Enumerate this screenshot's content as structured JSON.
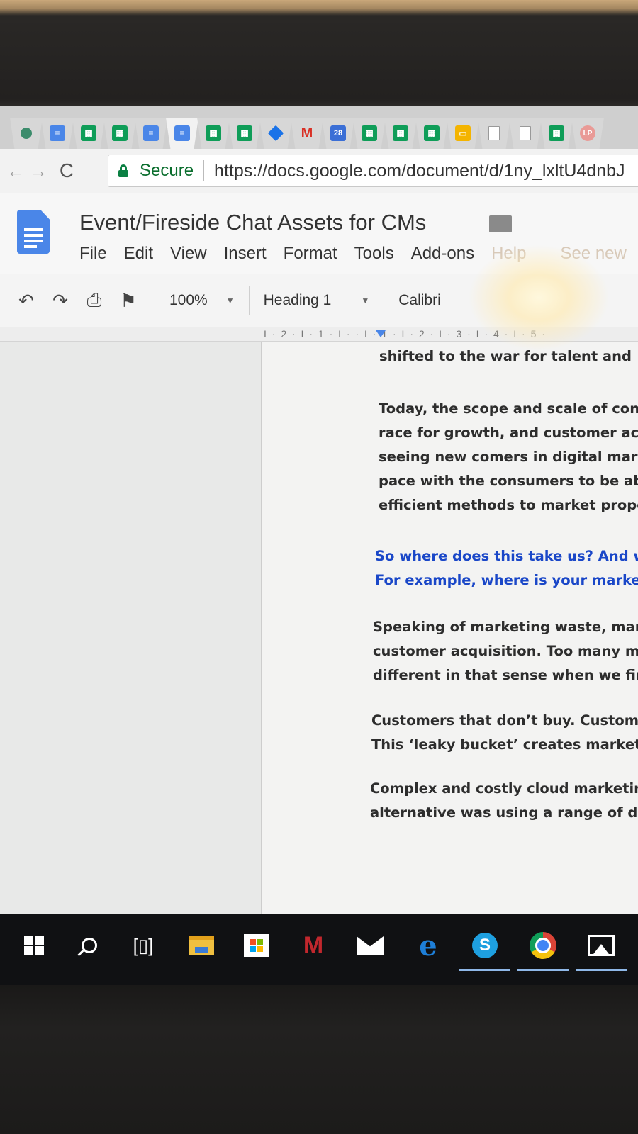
{
  "browser": {
    "tabs": [
      {
        "icon": "circle-icon"
      },
      {
        "icon": "docs-icon"
      },
      {
        "icon": "sheets-icon"
      },
      {
        "icon": "sheets-icon"
      },
      {
        "icon": "docs-icon"
      },
      {
        "icon": "docs-icon"
      },
      {
        "icon": "sheets-icon"
      },
      {
        "icon": "sheets-icon"
      },
      {
        "icon": "drive-icon"
      },
      {
        "icon": "gmail-icon",
        "glyph": "M"
      },
      {
        "icon": "calendar-icon",
        "glyph": "28"
      },
      {
        "icon": "sheets-icon"
      },
      {
        "icon": "sheets-icon"
      },
      {
        "icon": "sheets-icon"
      },
      {
        "icon": "slides-icon"
      },
      {
        "icon": "blank-page-icon"
      },
      {
        "icon": "blank-page-icon"
      },
      {
        "icon": "sheets-icon"
      },
      {
        "icon": "avatar-icon",
        "glyph": "LP"
      },
      {
        "icon": "blank-page-icon"
      }
    ],
    "secure_label": "Secure",
    "url": "https://docs.google.com/document/d/1ny_lxltU4dnbJ"
  },
  "docs": {
    "title": "Event/Fireside Chat Assets for CMs",
    "menu": [
      "File",
      "Edit",
      "View",
      "Insert",
      "Format",
      "Tools",
      "Add-ons",
      "Help",
      "See new"
    ],
    "toolbar": {
      "zoom": "100%",
      "style": "Heading 1",
      "font": "Calibri"
    },
    "ruler": "I · 2 · I · 1 · I ·   · I · 1 · I · 2 · I · 3 · I · 4 · I · 5 ·"
  },
  "document": {
    "paragraphs": [
      {
        "lines": [
          "shifted to the war for talent and"
        ],
        "style": "normal"
      },
      {
        "lines": [
          "Today, the scope and scale of con",
          "race for growth, and customer acc",
          "seeing new comers in digital mark",
          "pace with the consumers to be ab",
          "efficient methods to market prope"
        ],
        "style": "normal"
      },
      {
        "lines": [
          "So where does this take us? And w",
          "For example, where is your market"
        ],
        "style": "blue"
      },
      {
        "lines": [
          "Speaking of marketing waste, man",
          "customer acquisition. Too many ma",
          "different in that sense when we firs"
        ],
        "style": "normal"
      },
      {
        "lines": [
          "Customers that don’t buy. Custome",
          "This ‘leaky bucket’ creates marketin"
        ],
        "style": "normal"
      },
      {
        "lines": [
          "Complex and costly cloud marketing",
          "alternative was using a range of diff"
        ],
        "style": "normal"
      }
    ]
  },
  "taskbar": {
    "apps": [
      "windows-start-icon",
      "search-icon",
      "task-view-icon",
      "file-explorer-icon",
      "store-icon",
      "mcafee-icon",
      "mail-icon",
      "edge-icon",
      "skype-icon",
      "chrome-icon",
      "photos-icon"
    ]
  },
  "colors": {
    "doc_blue": "#4a86e8",
    "sheet_green": "#0f9d58",
    "link_blue_text": "#1a47c8",
    "secure_green": "#0b8043"
  }
}
